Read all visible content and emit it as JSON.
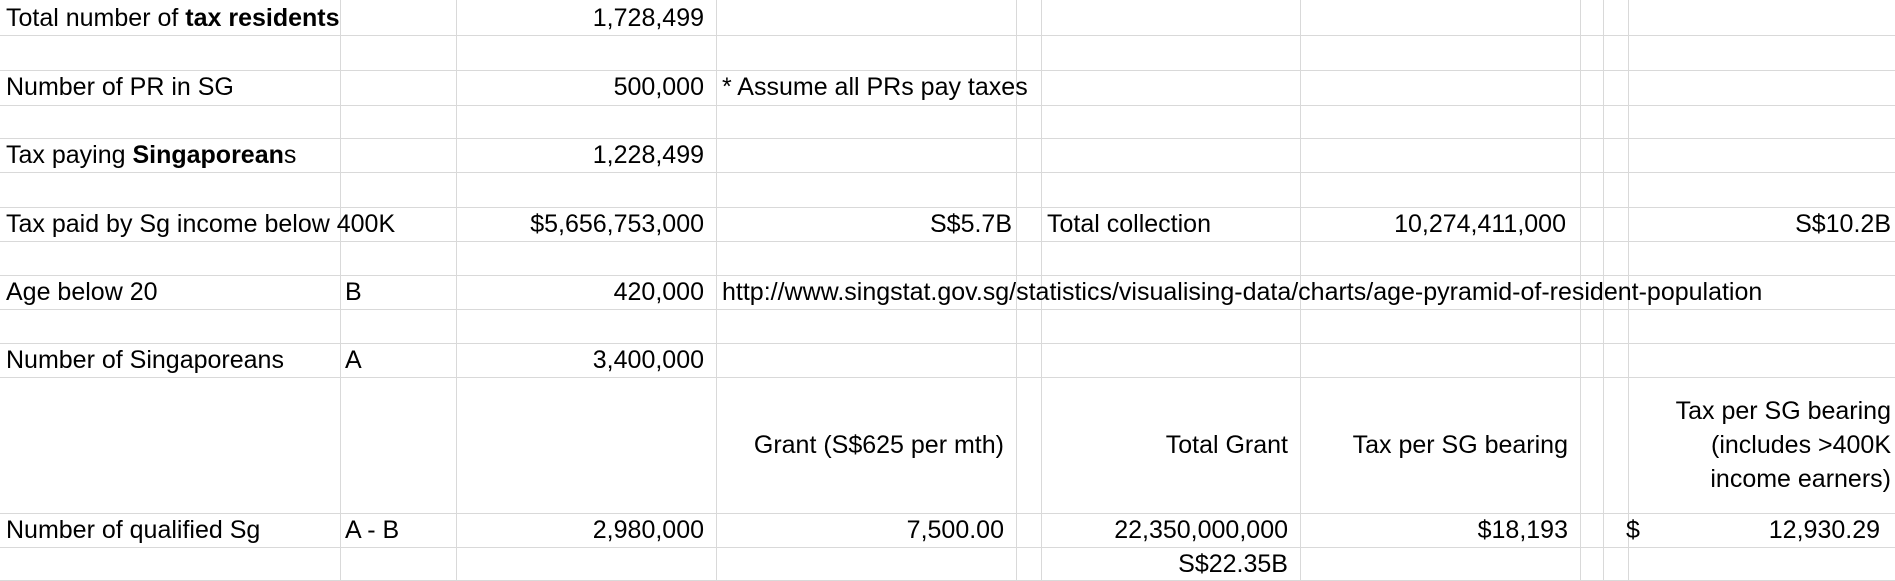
{
  "rows": {
    "tax_residents": {
      "label_pre": "Total number of ",
      "label_bold": "tax residents",
      "value": "1,728,499"
    },
    "pr": {
      "label": "Number of PR in SG",
      "value": "500,000",
      "note": "* Assume all PRs pay taxes"
    },
    "tax_paying": {
      "label_pre": "Tax paying ",
      "label_bold": "Singaporean",
      "label_post": "s",
      "value": "1,228,499"
    },
    "tax_paid": {
      "label": "Tax paid by Sg income below 400K",
      "value": "$5,656,753,000",
      "short": "S$5.7B",
      "total_label": "Total collection",
      "total_value": "10,274,411,000",
      "total_short": "S$10.2B"
    },
    "age": {
      "label": "Age below 20",
      "code": "B",
      "value": "420,000",
      "link": "http://www.singstat.gov.sg/statistics/visualising-data/charts/age-pyramid-of-resident-population"
    },
    "singaporeans": {
      "label": "Number of Singaporeans",
      "code": "A",
      "value": "3,400,000"
    },
    "headers": {
      "grant": "Grant (S$625 per mth)",
      "total_grant": "Total Grant",
      "tax_per": "Tax per SG bearing",
      "tax_per_incl": "Tax per SG bearing (includes >400K income earners)"
    },
    "qualified": {
      "label": "Number of qualified Sg",
      "code": "A - B",
      "value": "2,980,000",
      "grant": "7,500.00",
      "total_grant": "22,350,000,000",
      "tax_per": "$18,193",
      "currency": "$",
      "tax_per_incl": "12,930.29"
    },
    "total_grant_short": "S$22.35B"
  }
}
